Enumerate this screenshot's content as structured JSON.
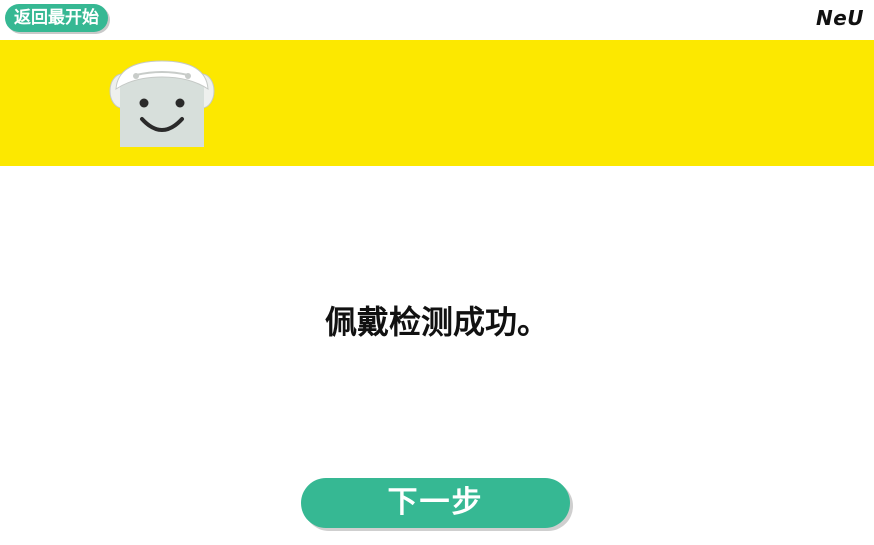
{
  "header": {
    "back_label": "返回最开始",
    "brand": "NeU"
  },
  "banner": {
    "color": "#fce800",
    "mascot_icon": "smiling-face-headband-icon"
  },
  "main": {
    "message": "佩戴检测成功。"
  },
  "footer": {
    "next_label": "下一步"
  },
  "colors": {
    "accent": "#36b893",
    "banner": "#fce800",
    "text": "#111111"
  }
}
